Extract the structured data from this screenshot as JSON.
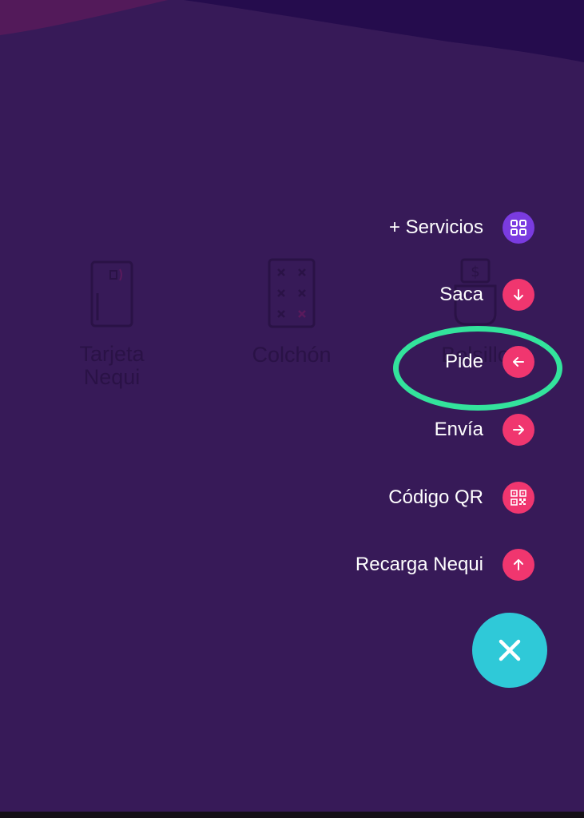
{
  "background": {
    "color": "#371a58",
    "header_color": "#250c4d",
    "accent_blob": "#5a1a5c"
  },
  "pockets": [
    {
      "label": "Tarjeta\nNequi",
      "icon": "card-icon"
    },
    {
      "label": "Colchón",
      "icon": "mattress-icon"
    },
    {
      "label": "Bolsillo",
      "icon": "jar-icon"
    }
  ],
  "menu": {
    "items": [
      {
        "label": "+ Servicios",
        "icon": "grid-icon",
        "color": "#7a3be0"
      },
      {
        "label": "Saca",
        "icon": "arrow-down-icon",
        "color": "#f0366f"
      },
      {
        "label": "Pide",
        "icon": "arrow-left-icon",
        "color": "#f0366f"
      },
      {
        "label": "Envía",
        "icon": "arrow-right-icon",
        "color": "#f0366f"
      },
      {
        "label": "Código QR",
        "icon": "qr-code-icon",
        "color": "#f0366f"
      },
      {
        "label": "Recarga Nequi",
        "icon": "arrow-up-icon",
        "color": "#f0366f"
      }
    ],
    "highlighted_item": "Pide",
    "highlight_color": "#33e39c"
  },
  "close_button": {
    "icon": "close-icon",
    "color": "#2fc9d8"
  }
}
